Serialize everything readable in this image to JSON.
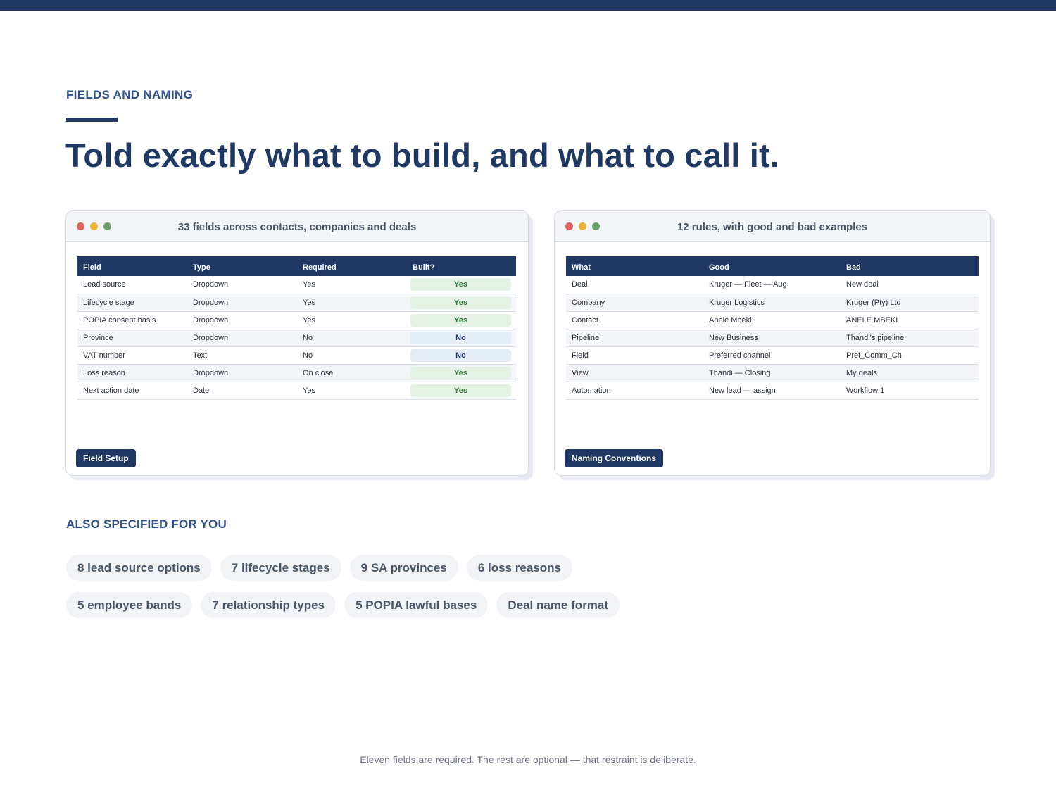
{
  "header": {
    "eyebrow": "FIELDS AND NAMING",
    "headline": "Told exactly what to build, and what to call it."
  },
  "field_window": {
    "title": "33 fields across contacts, companies and deals",
    "columns": [
      "Field",
      "Type",
      "Required",
      "Built?"
    ],
    "rows": [
      {
        "field": "Lead source",
        "type": "Dropdown",
        "required": "Yes",
        "built": "Yes"
      },
      {
        "field": "Lifecycle stage",
        "type": "Dropdown",
        "required": "Yes",
        "built": "Yes"
      },
      {
        "field": "POPIA consent basis",
        "type": "Dropdown",
        "required": "Yes",
        "built": "Yes"
      },
      {
        "field": "Province",
        "type": "Dropdown",
        "required": "No",
        "built": "No"
      },
      {
        "field": "VAT number",
        "type": "Text",
        "required": "No",
        "built": "No"
      },
      {
        "field": "Loss reason",
        "type": "Dropdown",
        "required": "On close",
        "built": "Yes"
      },
      {
        "field": "Next action date",
        "type": "Date",
        "required": "Yes",
        "built": "Yes"
      }
    ],
    "tag": "Field Setup"
  },
  "naming_window": {
    "title": "12 rules, with good and bad examples",
    "columns": [
      "What",
      "Good",
      "Bad"
    ],
    "rows": [
      {
        "what": "Deal",
        "good": "Kruger — Fleet — Aug",
        "bad": "New deal"
      },
      {
        "what": "Company",
        "good": "Kruger Logistics",
        "bad": "Kruger (Pty) Ltd"
      },
      {
        "what": "Contact",
        "good": "Anele Mbeki",
        "bad": "ANELE MBEKI"
      },
      {
        "what": "Pipeline",
        "good": "New Business",
        "bad": "Thandi's pipeline"
      },
      {
        "what": "Field",
        "good": "Preferred channel",
        "bad": "Pref_Comm_Ch"
      },
      {
        "what": "View",
        "good": "Thandi — Closing",
        "bad": "My deals"
      },
      {
        "what": "Automation",
        "good": "New lead — assign",
        "bad": "Workflow 1"
      }
    ],
    "tag": "Naming Conventions"
  },
  "also_specified": {
    "label": "ALSO SPECIFIED FOR YOU",
    "chips_row1": [
      "8 lead source options",
      "7 lifecycle stages",
      "9 SA provinces",
      "6 loss reasons"
    ],
    "chips_row2": [
      "5 employee bands",
      "7 relationship types",
      "5 POPIA lawful bases",
      "Deal name format"
    ]
  },
  "footer": {
    "note": "Eleven fields are required. The rest are optional — that restraint is deliberate."
  },
  "colors": {
    "navy": "#1f3864",
    "accent_blue": "#2d4f8e",
    "yes_bg": "#e6f1e6",
    "yes_text": "#2e7d3a",
    "no_bg": "#e4ecf6"
  }
}
